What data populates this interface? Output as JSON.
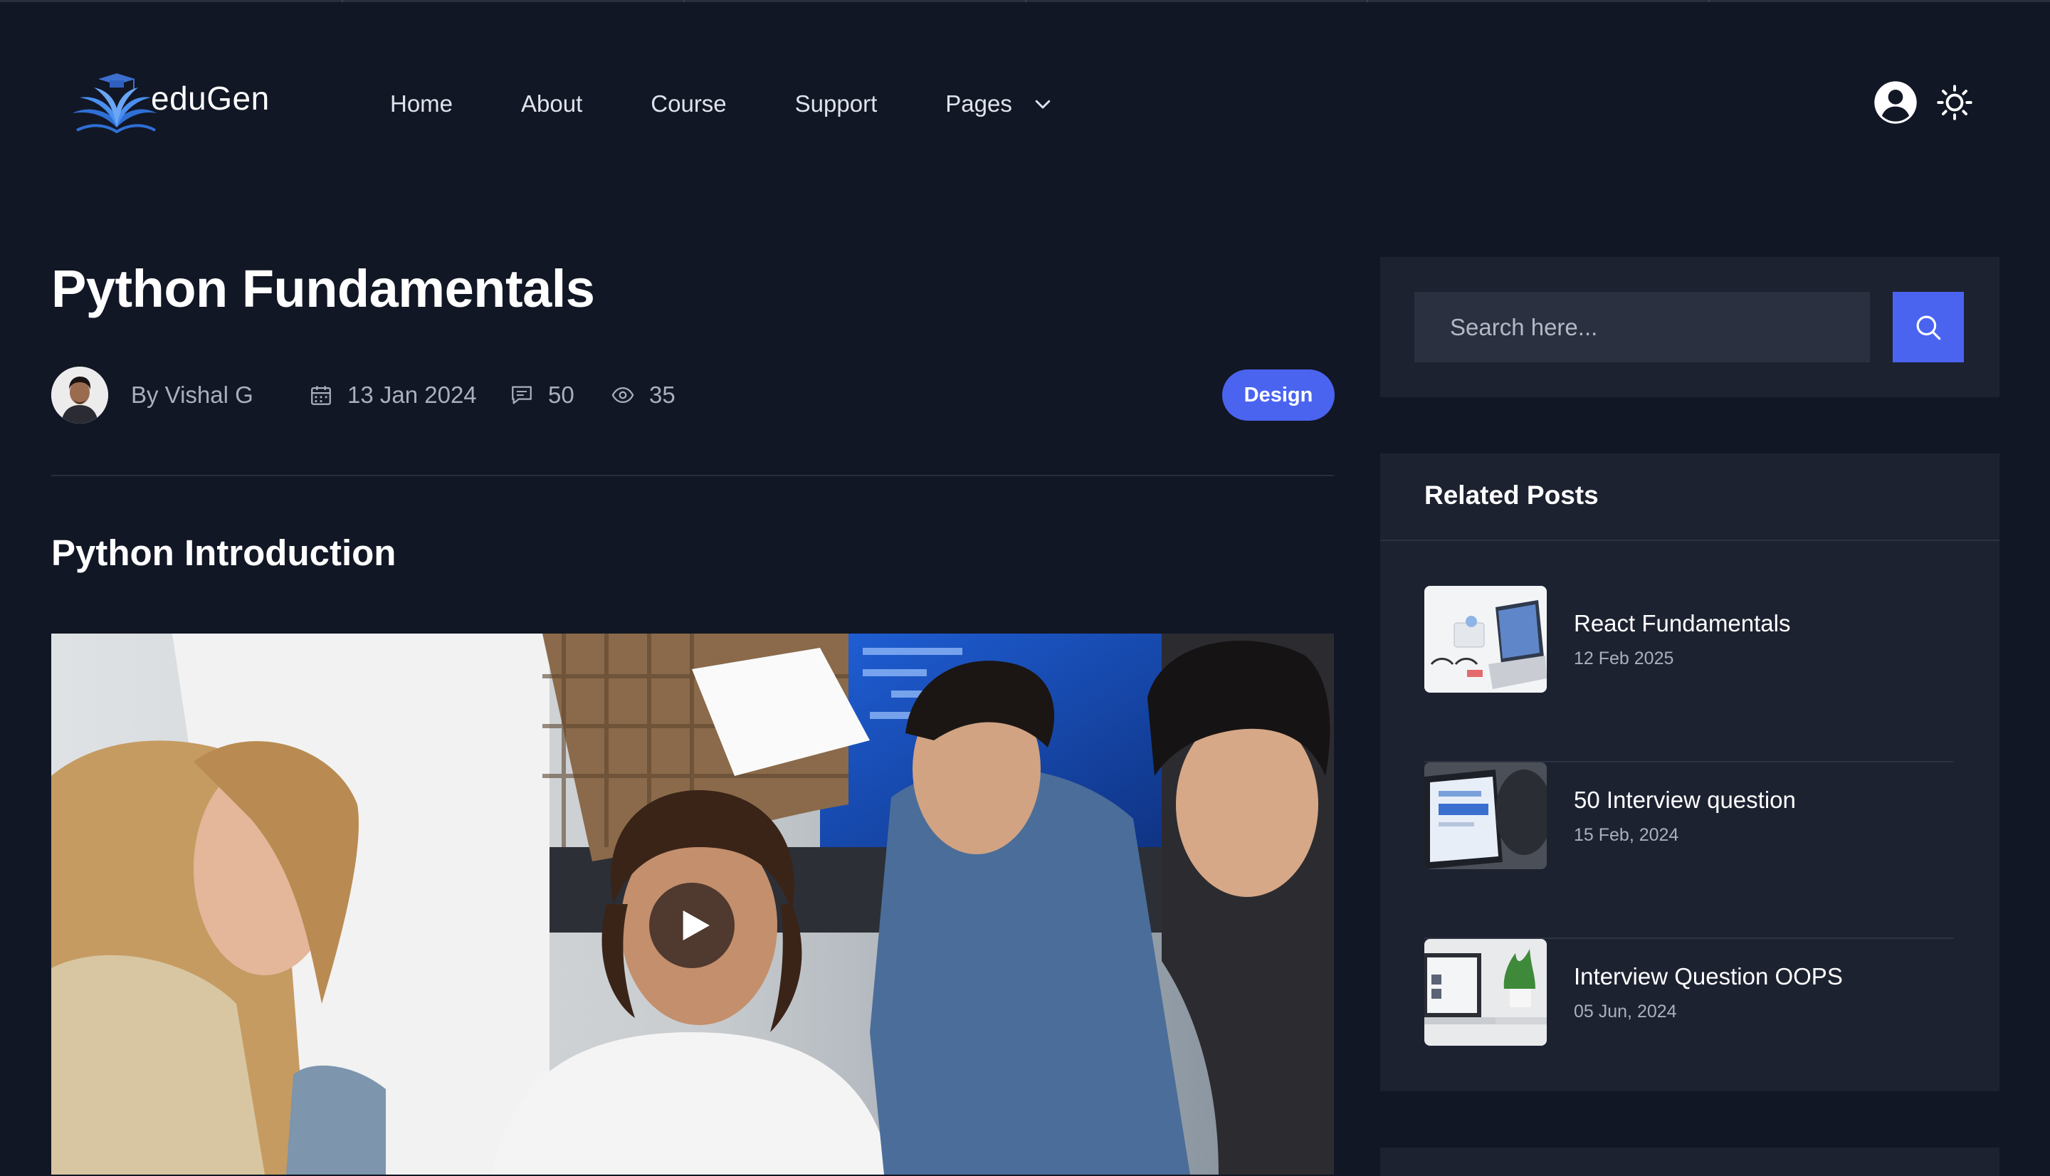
{
  "brand": {
    "name": "eduGen"
  },
  "nav": {
    "items": [
      {
        "label": "Home"
      },
      {
        "label": "About"
      },
      {
        "label": "Course"
      },
      {
        "label": "Support"
      },
      {
        "label": "Pages"
      }
    ]
  },
  "post": {
    "title": "Python Fundamentals",
    "author": "By Vishal G",
    "date": "13 Jan 2024",
    "comments": "50",
    "views": "35",
    "category": "Design",
    "section_title": "Python Introduction"
  },
  "search": {
    "placeholder": "Search here..."
  },
  "related": {
    "title": "Related Posts",
    "posts": [
      {
        "title": "React Fundamentals",
        "date": "12 Feb 2025"
      },
      {
        "title": "50 Interview question",
        "date": "15 Feb, 2024"
      },
      {
        "title": "Interview Question OOPS",
        "date": "05 Jun, 2024"
      }
    ]
  },
  "colors": {
    "background": "#121725",
    "card": "#1d2231",
    "accent": "#4a64f0",
    "muted_text": "#a8afbd"
  },
  "icons": [
    "edugen-logo",
    "chevron-down-icon",
    "user-circle-icon",
    "sun-icon",
    "calendar-icon",
    "comment-icon",
    "eye-icon",
    "search-icon",
    "play-icon"
  ]
}
